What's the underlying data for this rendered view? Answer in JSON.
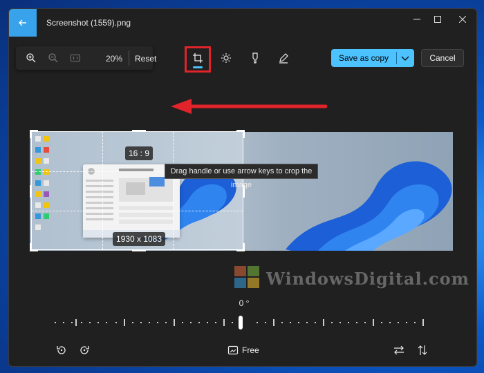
{
  "window": {
    "title": "Screenshot (1559).png"
  },
  "zoom": {
    "percent": "20%",
    "reset_label": "Reset"
  },
  "actions": {
    "save_label": "Save as copy",
    "cancel_label": "Cancel"
  },
  "crop": {
    "aspect_ratio": "16 : 9",
    "dimensions": "1930 x 1083",
    "tooltip": "Drag handle or use arrow keys to crop the image"
  },
  "rotation": {
    "angle": "0 °",
    "aspect_mode": "Free"
  },
  "watermark": {
    "text": "WindowsDigital.com"
  },
  "colors": {
    "accent": "#4cc2ff",
    "highlight": "#e0242a",
    "background": "#202020"
  },
  "icons": {
    "back": "arrow-left-icon",
    "zoom_in": "zoom-in-icon",
    "zoom_out": "zoom-out-icon",
    "actual_size": "actual-size-icon",
    "crop": "crop-icon",
    "adjust": "brightness-icon",
    "filter": "filter-icon",
    "markup": "markup-pen-icon",
    "rotate_left": "rotate-left-icon",
    "rotate_right": "rotate-right-icon",
    "aspect": "aspect-ratio-icon",
    "flip_h": "flip-horizontal-icon",
    "flip_v": "flip-vertical-icon"
  }
}
